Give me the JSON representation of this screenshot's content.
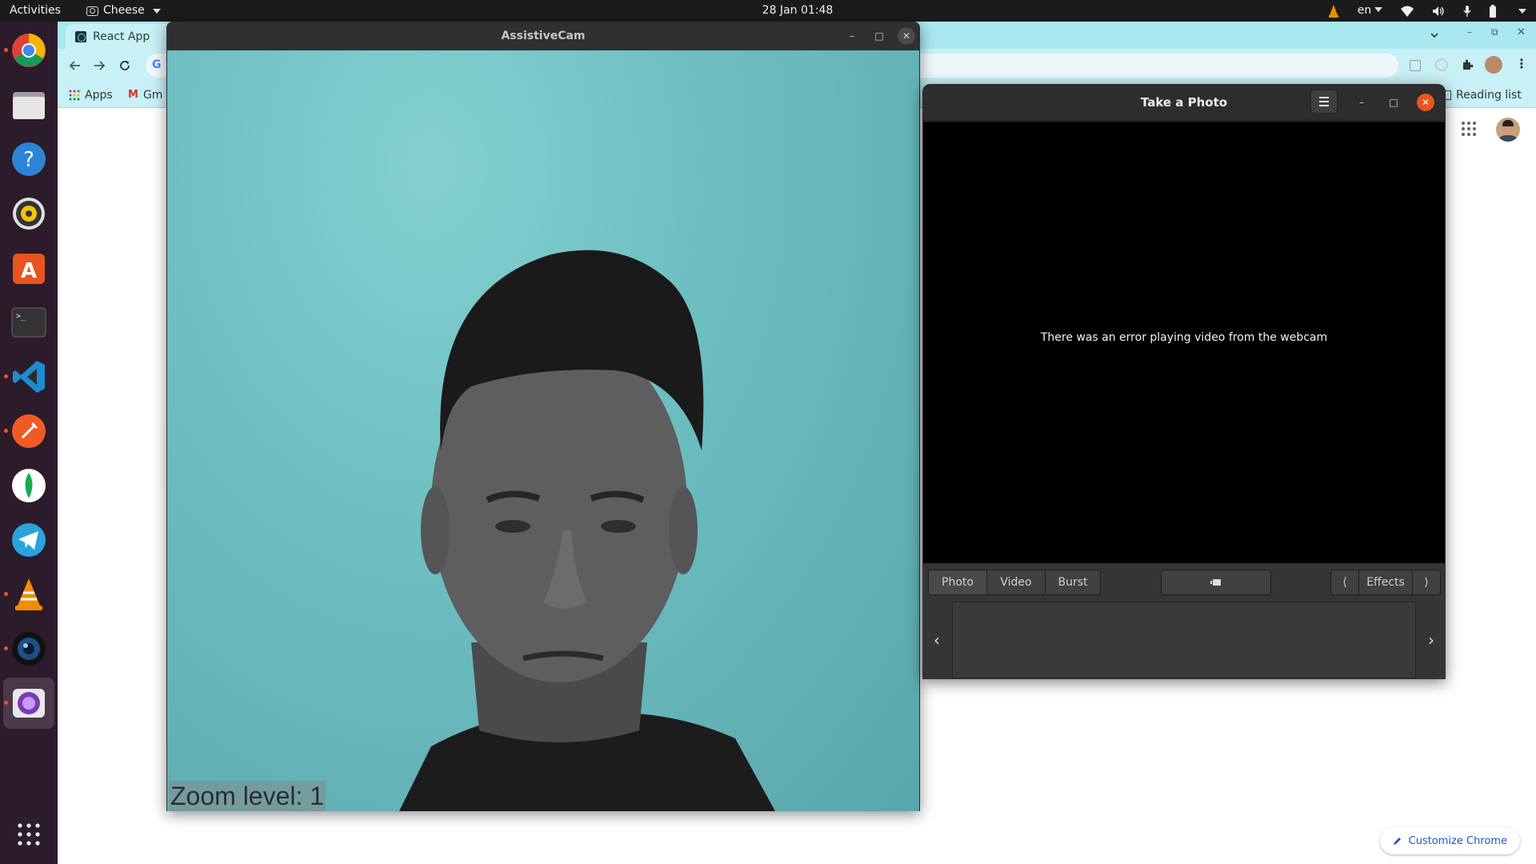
{
  "topbar": {
    "activities": "Activities",
    "app_name": "Cheese",
    "clock": "28 Jan  01:48",
    "language": "en"
  },
  "chrome": {
    "tab_title": "React App",
    "bookmarks": {
      "apps": "Apps",
      "gmail": "Gm",
      "reading_list": "Reading list"
    },
    "customize_label": "Customize Chrome"
  },
  "assistivecam": {
    "title": "AssistiveCam",
    "zoom_label": "Zoom level: 1"
  },
  "cheese": {
    "title": "Take a Photo",
    "error_message": "There was an error playing video from the webcam",
    "modes": [
      "Photo",
      "Video",
      "Burst"
    ],
    "effects_label": "Effects",
    "accent": "#e95420"
  },
  "dock": {
    "items": [
      "chrome-icon",
      "files-icon",
      "help-icon",
      "rhythmbox-icon",
      "software-icon",
      "terminal-icon",
      "vscode-icon",
      "postman-icon",
      "mongodb-compass-icon",
      "telegram-icon",
      "vlc-icon",
      "webcamoid-icon",
      "cheese-icon",
      "show-apps-icon"
    ]
  }
}
